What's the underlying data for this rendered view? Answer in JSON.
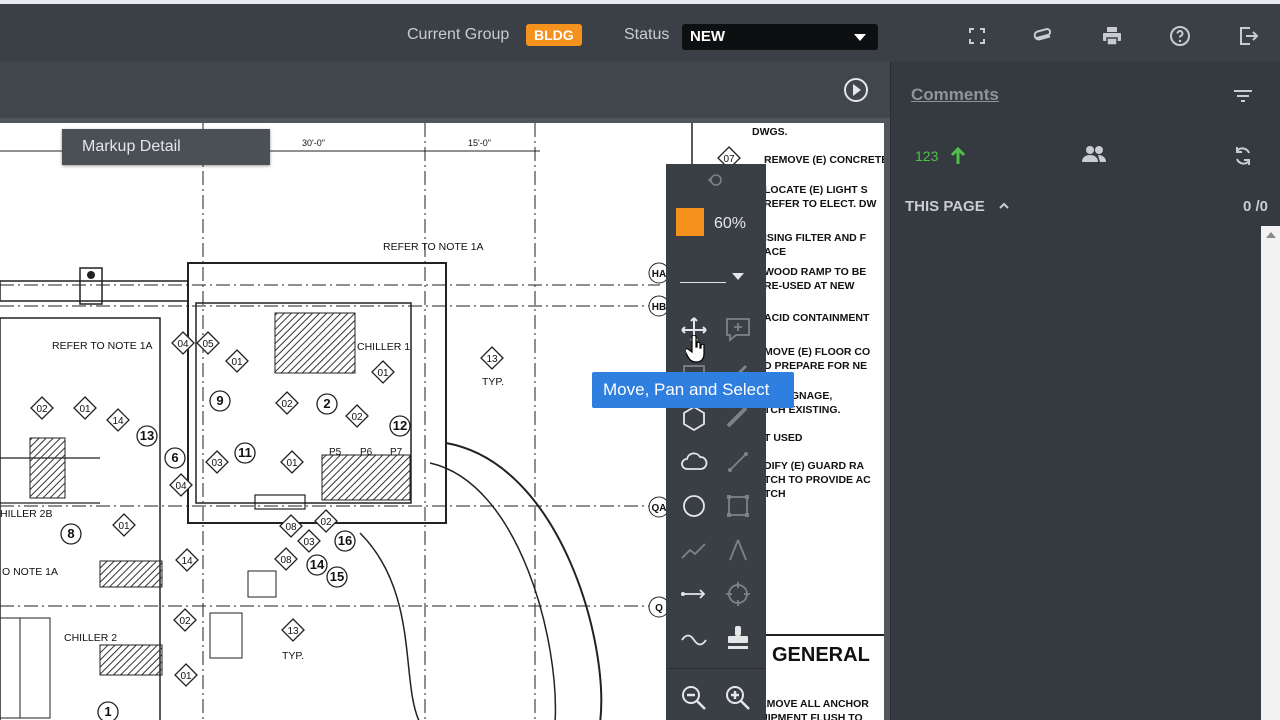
{
  "header": {
    "current_group_label": "Current Group",
    "current_group_value": "BLDG",
    "status_label": "Status",
    "status_value": "NEW",
    "icons": [
      "fullscreen-icon",
      "attachment-icon",
      "print-icon",
      "help-icon",
      "exit-icon"
    ]
  },
  "markup_detail": {
    "label": "Markup Detail"
  },
  "toolbox": {
    "opacity": "60%",
    "color": "#f5921e",
    "tools": [
      "move-pan-select",
      "add-comment",
      "rectangle",
      "pen",
      "polygon",
      "measure",
      "cloud",
      "line",
      "circle",
      "area",
      "polyline",
      "angle",
      "arrow",
      "count",
      "freehand",
      "stamp",
      "zoom-out",
      "zoom-in"
    ]
  },
  "tooltip": {
    "text": "Move, Pan and Select"
  },
  "comments_panel": {
    "title": "Comments",
    "count": "123",
    "section": "THIS PAGE",
    "page_count": "0 /0"
  },
  "drawing": {
    "notes": {
      "refer_1a_top": "REFER TO NOTE 1A",
      "refer_1a_left": "REFER TO NOTE 1A",
      "refer_1a_bottom": "O NOTE 1A",
      "chiller1": "CHILLER 1",
      "chiller2b": "HILLER 2B",
      "chiller2": "CHILLER 2",
      "typ1": "TYP.",
      "typ2": "TYP.",
      "dim1": "30'-0\"",
      "dim2": "15'-0\"",
      "grid_ha": "HA",
      "grid_hb": "HB",
      "grid_qa": "QA",
      "grid_q": "Q",
      "p5": "P5",
      "p6": "P6",
      "p7": "P7",
      "general": "GENERAL"
    },
    "spec_lines": [
      "DWGS.",
      "REMOVE (E) CONCRETE",
      "LOCATE (E) LIGHT S",
      "REFER TO ELECT. DW",
      "ISING FILTER AND F",
      "ACE",
      "WOOD RAMP TO BE",
      "RE-USED AT NEW",
      "ACID CONTAINMENT",
      "MOVE (E) FLOOR CO",
      "D PREPARE FOR NE",
      "(E) SIGNAGE,",
      "TCH EXISTING.",
      "T USED",
      "DIFY (E) GUARD RA",
      "TCH TO PROVIDE AC",
      "TCH",
      "REMOVE ALL ANCHOR",
      "QUIPMENT FLUSH TO"
    ],
    "tags": [
      "04",
      "05",
      "01",
      "01",
      "02",
      "9",
      "2",
      "02",
      "12",
      "13",
      "02",
      "01",
      "14",
      "13",
      "6",
      "03",
      "11",
      "01",
      "04",
      "8",
      "01",
      "14",
      "08",
      "02",
      "03",
      "16",
      "08",
      "14",
      "15",
      "02",
      "13",
      "01",
      "1",
      "07"
    ]
  }
}
